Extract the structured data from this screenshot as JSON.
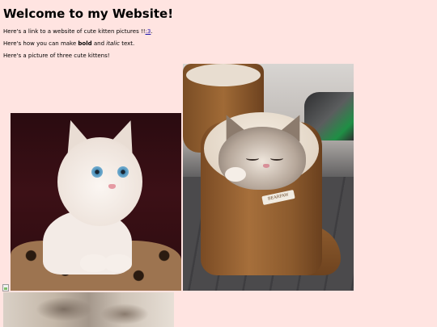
{
  "page": {
    "background": "#ffe4e1",
    "title": "Welcome to my Website!"
  },
  "paragraphs": {
    "link_intro": "Here's a link to a website of cute kitten pictures !!",
    "link_text": ":3",
    "link_end": ".",
    "format_prefix": "Here's how you can make ",
    "bold_word": "bold",
    "format_middle": " and ",
    "italic_word": "italic",
    "format_suffix": " text.",
    "picture_intro": "Here's a picture of three cute kittens!"
  },
  "images": {
    "kitten1_desc": "white kitten with blue eyes on leopard-print blanket",
    "kitten2_desc": "sleeping tabby kitten inside a brown boot",
    "kitten2_tag": "BEARPAW",
    "broken_icon": "broken-image-icon",
    "kitten3_desc": "partially visible blurred kitten photo"
  },
  "colors": {
    "link": "#1a0dab",
    "page_bg": "#ffe4e1"
  }
}
